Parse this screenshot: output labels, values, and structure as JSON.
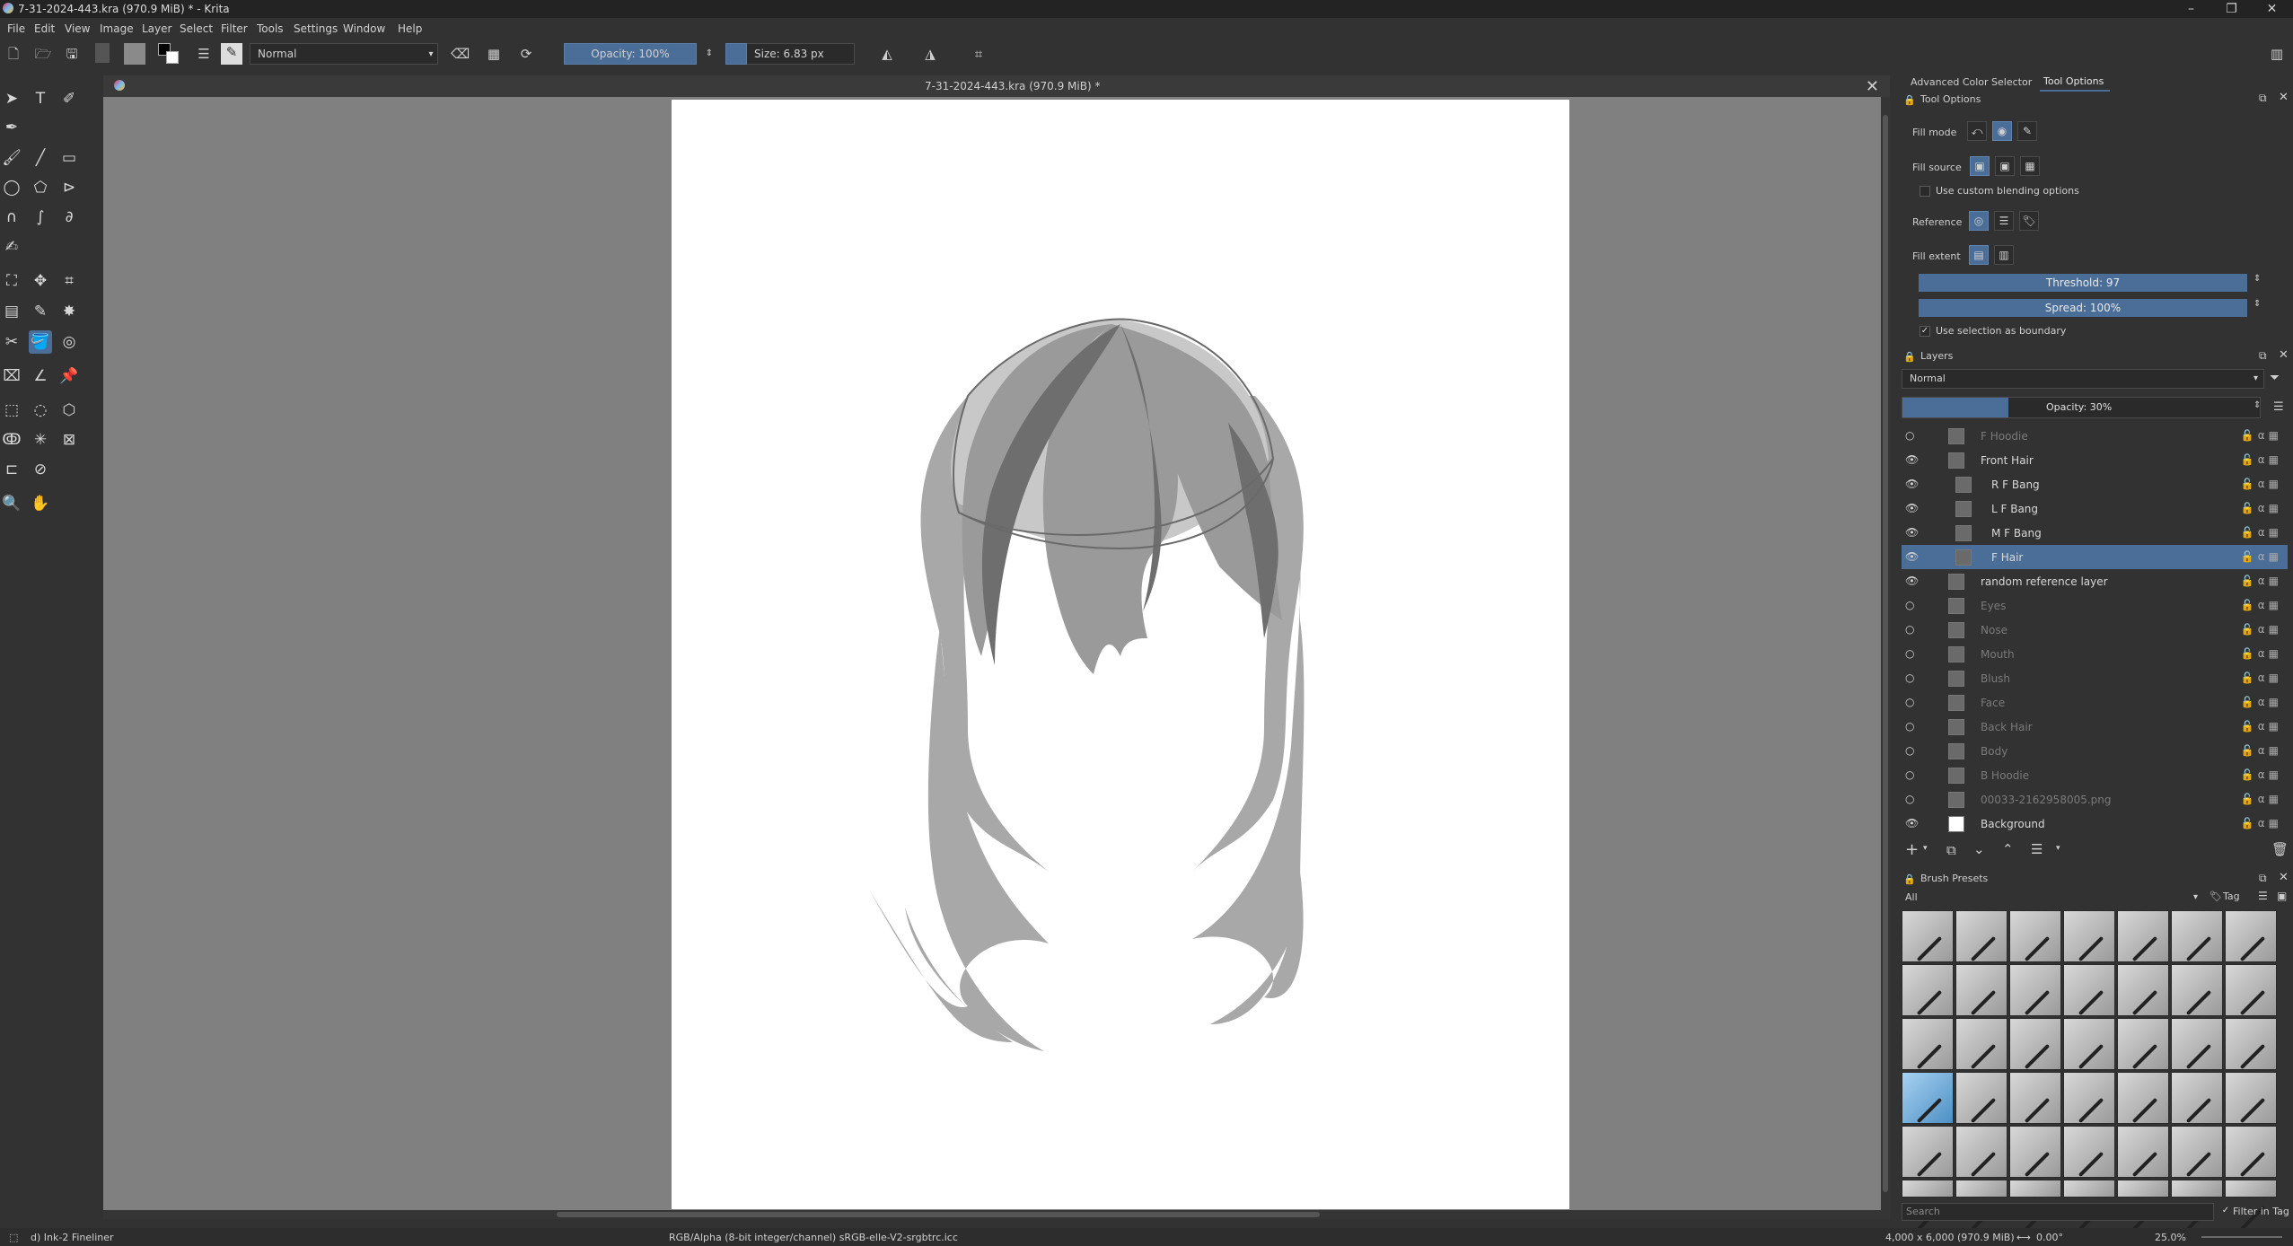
{
  "window": {
    "title": "7-31-2024-443.kra (970.9 MiB) * - Krita",
    "minimize": "–",
    "maximize": "❐",
    "close": "✕"
  },
  "menu": [
    "File",
    "Edit",
    "View",
    "Image",
    "Layer",
    "Select",
    "Filter",
    "Tools",
    "Settings",
    "Window",
    "Help"
  ],
  "toolbar": {
    "blend_mode": "Normal",
    "opacity": "Opacity: 100%",
    "size": "Size: 6.83 px"
  },
  "document_tab": {
    "title": "7-31-2024-443.kra (970.9 MiB) *",
    "close": "✕"
  },
  "dockers": {
    "tabs": [
      "Advanced Color Selector",
      "Tool Options"
    ],
    "tool_options": {
      "header": "Tool Options",
      "fill_mode_label": "Fill mode",
      "fill_source_label": "Fill source",
      "custom_blending": "Use custom blending options",
      "reference_label": "Reference",
      "fill_extent_label": "Fill extent",
      "threshold": "Threshold: 97",
      "spread": "Spread: 100%",
      "selection_boundary": "Use selection as boundary"
    },
    "layers": {
      "header": "Layers",
      "blend_mode": "Normal",
      "opacity": "Opacity:  30%",
      "items": [
        {
          "name": "F Hoodie",
          "visible": false,
          "indent": 0
        },
        {
          "name": "Front Hair",
          "visible": true,
          "indent": 0
        },
        {
          "name": "R F Bang",
          "visible": true,
          "indent": 1
        },
        {
          "name": "L F Bang",
          "visible": true,
          "indent": 1
        },
        {
          "name": "M F Bang",
          "visible": true,
          "indent": 1
        },
        {
          "name": "F Hair",
          "visible": true,
          "indent": 1
        },
        {
          "name": "random reference layer",
          "visible": true,
          "indent": 0
        },
        {
          "name": "Eyes",
          "visible": false,
          "indent": 0
        },
        {
          "name": "Nose",
          "visible": false,
          "indent": 0
        },
        {
          "name": "Mouth",
          "visible": false,
          "indent": 0
        },
        {
          "name": "Blush",
          "visible": false,
          "indent": 0
        },
        {
          "name": "Face",
          "visible": false,
          "indent": 0
        },
        {
          "name": "Back Hair",
          "visible": false,
          "indent": 0
        },
        {
          "name": "Body",
          "visible": false,
          "indent": 0
        },
        {
          "name": "B Hoodie",
          "visible": false,
          "indent": 0
        },
        {
          "name": "00033-2162958005.png",
          "visible": false,
          "indent": 0
        },
        {
          "name": "Background",
          "visible": true,
          "indent": 0
        }
      ]
    },
    "brush_presets": {
      "header": "Brush Presets",
      "filter": "All",
      "tag": "Tag",
      "search_placeholder": "Search",
      "filter_in_tag": "Filter in Tag"
    }
  },
  "statusbar": {
    "brush": "d) Ink-2 Fineliner",
    "color_profile": "RGB/Alpha (8-bit integer/channel)  sRGB-elle-V2-srgbtrc.icc",
    "dimensions": "4,000 x 6,000 (970.9 MiB)",
    "rotation": "0.00°",
    "zoom": "25.0%"
  },
  "colors": {
    "accent": "#4b6e98",
    "bg": "#323232",
    "canvas_bg": "#808080",
    "paper": "#ffffff",
    "hair_light": "#a8a8a8",
    "hair_dark": "#6e6e6e"
  }
}
